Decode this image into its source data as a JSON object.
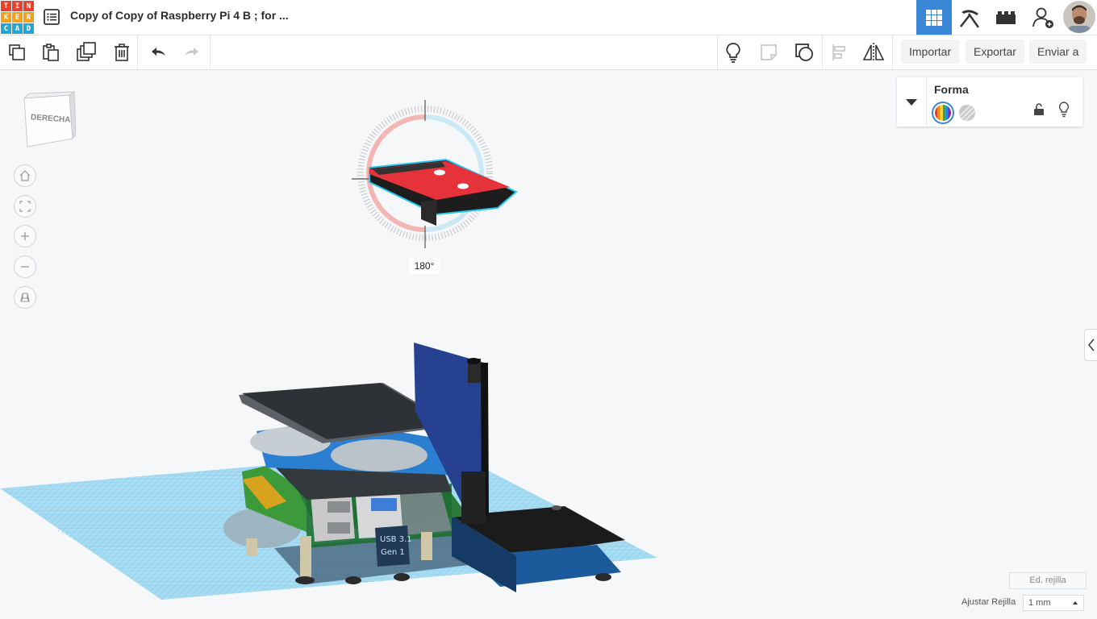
{
  "app": {
    "logo_letters": [
      "T",
      "I",
      "N",
      "K",
      "E",
      "R",
      "C",
      "A",
      "D"
    ],
    "logo_colors": [
      "#e8412c",
      "#e8412c",
      "#e8412c",
      "#f6a01a",
      "#f6a01a",
      "#f6a01a",
      "#23a5d6",
      "#23a5d6",
      "#23a5d6"
    ],
    "title": "Copy of Copy of Raspberry Pi 4 B ; for ...",
    "accent": "#3a87d6"
  },
  "header_icons": [
    "3d-design-grid-icon",
    "pickaxe-icon",
    "bricks-icon",
    "add-user-icon",
    "avatar"
  ],
  "toolbar": {
    "left_icons": [
      "copy-icon",
      "paste-icon",
      "duplicate-icon",
      "trash-icon",
      "undo-icon",
      "redo-icon"
    ],
    "right_icons": [
      "lightbulb-icon",
      "note-icon",
      "group-icon",
      "align-icon",
      "mirror-icon"
    ],
    "import_label": "Importar",
    "export_label": "Exportar",
    "send_label": "Enviar a"
  },
  "viewcube": {
    "label": "DERECHA"
  },
  "view_controls": [
    "home-icon",
    "fit-view-icon",
    "zoom-in-icon",
    "zoom-out-icon",
    "perspective-icon"
  ],
  "rotation": {
    "angle_label": "180°"
  },
  "shape_panel": {
    "title": "Forma",
    "solid_icon": "color-wheel-icon",
    "hole_icon": "hole-pattern-icon",
    "lock_icon": "lock-icon",
    "visibility_icon": "lightbulb-icon"
  },
  "grid": {
    "edit_label": "Ed. rejilla",
    "snap_label": "Ajustar Rejilla",
    "snap_value": "1 mm"
  }
}
